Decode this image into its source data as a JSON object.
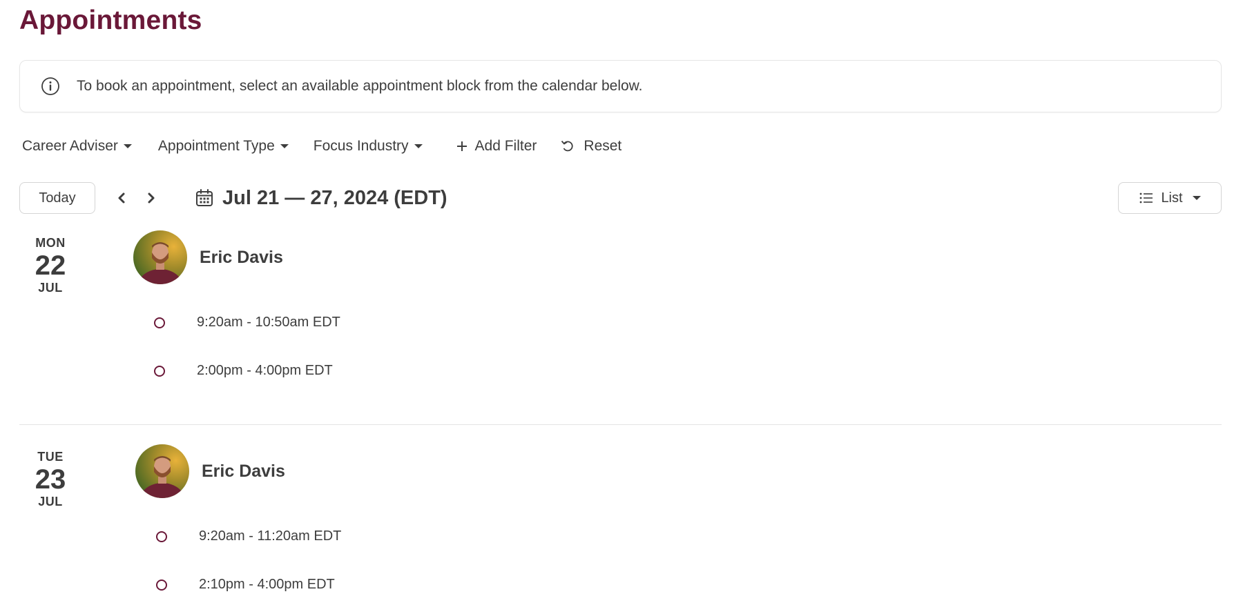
{
  "page": {
    "title": "Appointments"
  },
  "banner": {
    "icon": "info-circle-icon",
    "text": "To book an appointment, select an available appointment block from the calendar below."
  },
  "filters": {
    "items": [
      {
        "label": "Career Adviser",
        "icon": "caret-down-icon"
      },
      {
        "label": "Appointment Type",
        "icon": "caret-down-icon"
      },
      {
        "label": "Focus Industry",
        "icon": "caret-down-icon"
      }
    ],
    "add_filter_label": "Add Filter",
    "reset_label": "Reset"
  },
  "toolbar": {
    "today_label": "Today",
    "date_range": "Jul 21 — 27, 2024 (EDT)",
    "view_label": "List"
  },
  "days": [
    {
      "dow": "MON",
      "day": "22",
      "month": "JUL",
      "adviser": "Eric Davis",
      "slots": [
        "9:20am - 10:50am EDT",
        "2:00pm - 4:00pm EDT"
      ]
    },
    {
      "dow": "TUE",
      "day": "23",
      "month": "JUL",
      "adviser": "Eric Davis",
      "slots": [
        "9:20am - 11:20am EDT",
        "2:10pm - 4:00pm EDT"
      ]
    }
  ],
  "colors": {
    "brand": "#6a1838",
    "text": "#3d3d3d",
    "border": "#d4d4d4"
  }
}
